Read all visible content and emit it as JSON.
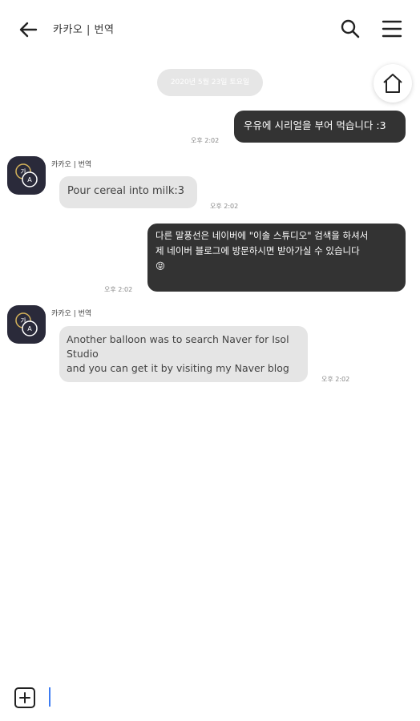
{
  "header": {
    "title": "카카오 | 번역",
    "back_icon": "arrow-left-icon",
    "search_icon": "search-icon",
    "menu_icon": "hamburger-menu-icon"
  },
  "fab": {
    "home_icon": "home-icon"
  },
  "chat": {
    "date": "2020년 5월 23일 토요일",
    "sender_name": "카카오 | 번역",
    "messages": [
      {
        "side": "out",
        "text": "우유에 시리얼을 부어 먹습니다 :3",
        "time": "오후 2:02"
      },
      {
        "side": "in",
        "text": "Pour cereal into milk:3",
        "time": "오후 2:02"
      },
      {
        "side": "out",
        "text": "다른 말풍선은 네이버에 \"이솔 스튜디오\" 검색을 하셔서\n제 네이버 블로그에 방문하시면 받아가실 수 있습니다\n😝",
        "time": "오후 2:02"
      },
      {
        "side": "in",
        "text": "Another balloon was to search Naver for Isol Studio\nand you can get it by visiting my Naver blog",
        "time": "오후 2:02"
      }
    ]
  },
  "composer": {
    "add_icon": "plus-square-icon",
    "input_value": ""
  },
  "colors": {
    "outgoing_bubble": "#333333",
    "incoming_bubble": "#e5e5e5",
    "cursor": "#3d7cf2"
  }
}
